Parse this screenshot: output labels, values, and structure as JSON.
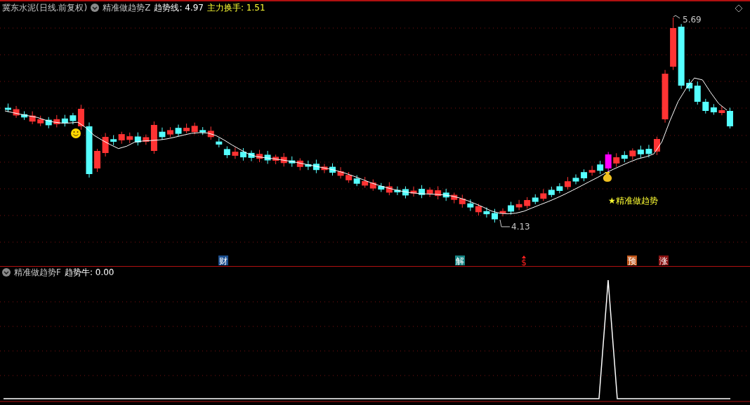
{
  "header": {
    "stock": "冀东水泥(日线.前复权)",
    "indicator": "精准做趋势Z",
    "line_label": "趋势线: 4.97",
    "turnover_label": "主力换手: 1.51"
  },
  "price_chart": {
    "high_label": "5.69",
    "low_label": "4.13",
    "signal_label": "★精准做趋势"
  },
  "event_markers": [
    {
      "label": "财",
      "kind": "tag",
      "color": "#1c4f8f"
    },
    {
      "label": "解",
      "kind": "tag",
      "color": "#178585"
    },
    {
      "label": "$",
      "kind": "sign",
      "color": "#ff2020"
    },
    {
      "label": "预",
      "kind": "tag",
      "color": "#c0561a"
    },
    {
      "label": "涨",
      "kind": "tag",
      "color": "#8a1212"
    }
  ],
  "sub_panel": {
    "indicator": "精准做趋势F",
    "value_label": "趋势牛: 0.00"
  }
}
